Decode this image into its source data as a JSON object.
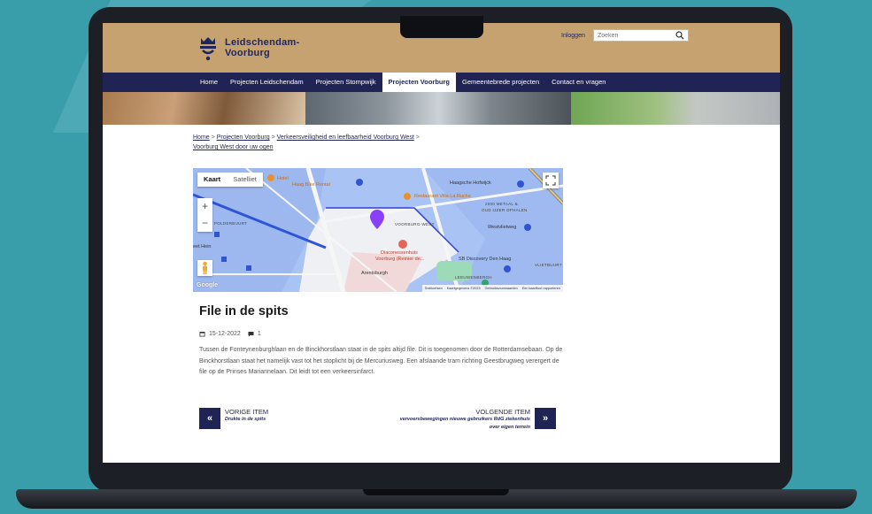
{
  "site": {
    "logo_line1": "Leidschendam-",
    "logo_line2": "Voorburg",
    "login_label": "Inloggen",
    "search_placeholder": "Zoeken"
  },
  "nav": {
    "items": [
      {
        "label": "Home"
      },
      {
        "label": "Projecten Leidschendam"
      },
      {
        "label": "Projecten Stompwijk"
      },
      {
        "label": "Projecten Voorburg"
      },
      {
        "label": "Gemeentebrede projecten"
      },
      {
        "label": "Contact en vragen"
      }
    ],
    "active_index": 3
  },
  "breadcrumb": {
    "items": [
      "Home",
      "Projecten Voorburg",
      "Verkeersveiligheid en leefbaarheid Voorburg West",
      "Voorburg West door uw ogen"
    ],
    "separator": ">"
  },
  "map": {
    "type_map": "Kaart",
    "type_satellite": "Satelliet",
    "zoom_in": "+",
    "zoom_out": "−",
    "labels": {
      "hotel": "Hotel",
      "haag_bike": "Haag Bike Rental",
      "restaurant": "Restaurant Villa La Ruche",
      "haagsehout": "Haagsche Hofwijck",
      "metaal": "2000 METAAL &",
      "oud_ijzer": "OUD IJZER OPHALEN",
      "polderbuurt": "POLDERBUURT",
      "voorburg_west": "VOORBURG-WEST",
      "westvliet": "Westvlietweg",
      "diaconessen1": "Diaconessenhuis",
      "diaconessen2": "Voorburg (Reinier de...",
      "sb": "SB Discovery Den Haag",
      "arentsburgh": "Arentsburgh",
      "vliet": "VLIETBUURT",
      "leeuwenbergh": "LEEUWENBERGH",
      "park_hein": "eet Hein"
    },
    "google": "Google",
    "footer": [
      "Sneltoetsen",
      "Kaartgegevens ©2023",
      "Gebruiksvoorwaarden",
      "Een kaartfout rapporteren"
    ],
    "marker_color": "#8a3ffc"
  },
  "article": {
    "title": "File in de spits",
    "date": "15-12-2022",
    "comments": "1",
    "body": "Tussen de Fonteynenburghlaan en de Binckhorstlaan staat in de spits altijd file. Dit is toegenomen door de Rotterdamsebaan. Op de Binckhorstlaan staat het namelijk vast tot het stoplicht bij de Mercuriusweg. Een afslaande tram richting Geestbrugweg verergert de file op de Prinses Mariannelaan. Dit leidt tot een verkeersinfarct."
  },
  "pagination": {
    "prev_label": "VORIGE ITEM",
    "prev_title": "Drukte in de spits",
    "prev_arrow": "«",
    "next_label": "VOLGENDE ITEM",
    "next_title": "vervoersbewegingen nieuwe gebruikers RdG ziekenhuis over eigen terrein",
    "next_arrow": "»"
  },
  "colors": {
    "header_bg": "#c5a270",
    "nav_bg": "#1f2455",
    "background": "#3a9eaa"
  }
}
